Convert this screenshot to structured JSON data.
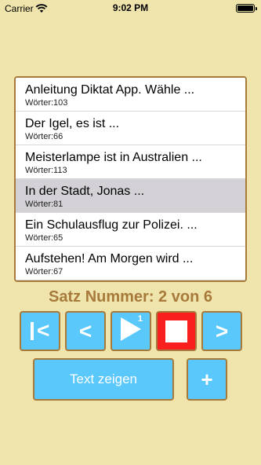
{
  "status_bar": {
    "carrier": "Carrier",
    "time": "9:02 PM"
  },
  "list": {
    "items": [
      {
        "title": "Anleitung Diktat App. Wähle ...",
        "count": "Wörter:103",
        "selected": false
      },
      {
        "title": "Der Igel, es ist ...",
        "count": "Wörter:66",
        "selected": false
      },
      {
        "title": "Meisterlampe ist in Australien ...",
        "count": "Wörter:113",
        "selected": false
      },
      {
        "title": "In der Stadt, Jonas ...",
        "count": "Wörter:81",
        "selected": true
      },
      {
        "title": "Ein Schulausflug zur Polizei. ...",
        "count": "Wörter:65",
        "selected": false
      },
      {
        "title": "Aufstehen! Am Morgen wird ...",
        "count": "Wörter:67",
        "selected": false
      }
    ]
  },
  "satz_label": "Satz Nummer: 2 von 6",
  "controls": {
    "prev_symbol": "<",
    "first_symbol": "<",
    "play_superscript": "1",
    "next_symbol": ">"
  },
  "buttons": {
    "text_zeigen": "Text zeigen",
    "plus": "+"
  },
  "colors": {
    "background": "#efe4ab",
    "border": "#a77a3b",
    "button_blue": "#5ac8fa",
    "stop_red": "#fa1f1f",
    "selected_row": "#d3d1d6"
  }
}
